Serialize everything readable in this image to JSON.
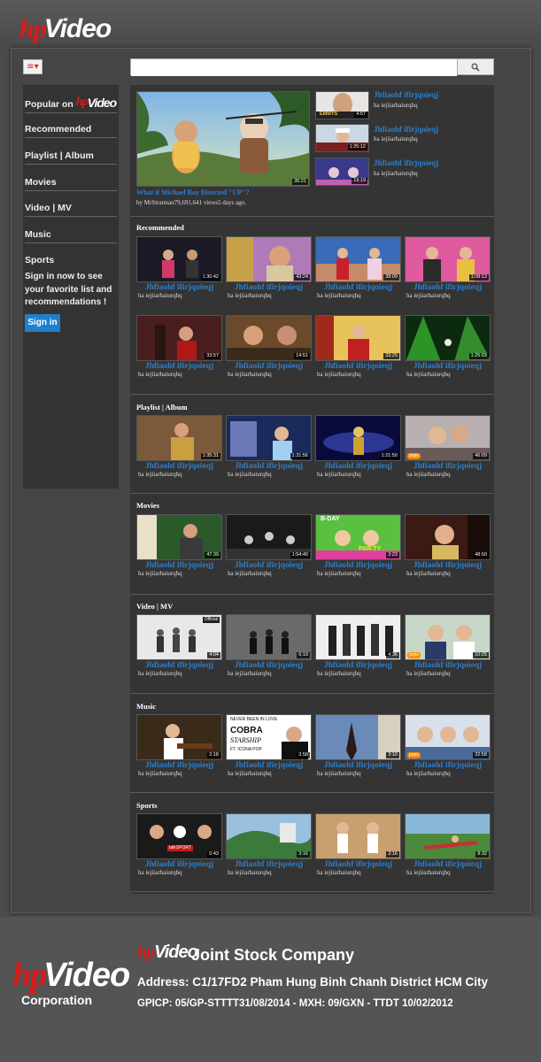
{
  "brand": {
    "hp": "hp",
    "video": "Video"
  },
  "search": {
    "placeholder": ""
  },
  "sidebar": {
    "popular_prefix": "Popular on",
    "items": [
      "Recommended",
      "Playlist | Album",
      "Movies",
      "Video | MV",
      "Music",
      "Sports"
    ],
    "prompt": "Sign in now to see your favorite list and recommendations !",
    "signin_label": "Sign in"
  },
  "featured": {
    "title": "What if Michael Bay Directed \"UP\"?",
    "meta": "by MrStratman79,691,641 views5 days ago.",
    "duration": "35:21",
    "side": [
      {
        "title": "Jhfiaohf ifirjqoieqj",
        "sub": "ha iejiiarhaiurqhq",
        "duration": "4:57"
      },
      {
        "title": "Jhfiaohf ifirjqoieqj",
        "sub": "ha iejiiarhaiurqhq",
        "duration": "1:25:12"
      },
      {
        "title": "Jhfiaohf ifirjqoieqj",
        "sub": "ha iejiiarhaiurqhq",
        "duration": "19:19"
      }
    ]
  },
  "sections": [
    {
      "title": "Recommended",
      "cards": [
        {
          "title": "Jhfiaohf ifirjqoieqj",
          "sub": "ha iejiiarhaiurqhq",
          "duration": "1:30:42"
        },
        {
          "title": "Jhfiaohf ifirjqoieqj",
          "sub": "ha iejiiarhaiurqhq",
          "duration": "43:24"
        },
        {
          "title": "Jhfiaohf ifirjqoieqj",
          "sub": "ha iejiiarhaiurqhq",
          "duration": "38:09"
        },
        {
          "title": "Jhfiaohf ifirjqoieqj",
          "sub": "ha iejiiarhaiurqhq",
          "duration": "1:08:13"
        },
        {
          "title": "Jhfiaohf ifirjqoieqj",
          "sub": "ha iejiiarhaiurqhq",
          "duration": "33:57"
        },
        {
          "title": "Jhfiaohf ifirjqoieqj",
          "sub": "ha iejiiarhaiurqhq",
          "duration": "14:51"
        },
        {
          "title": "Jhfiaohf ifirjqoieqj",
          "sub": "ha iejiiarhaiurqhq",
          "duration": "33:25"
        },
        {
          "title": "Jhfiaohf ifirjqoieqj",
          "sub": "ha iejiiarhaiurqhq",
          "duration": "1:25:03"
        }
      ]
    },
    {
      "title": "Playlist | Album",
      "cards": [
        {
          "title": "Jhfiaohf ifirjqoieqj",
          "sub": "ha iejiiarhaiurqhq",
          "duration": "1:35:31"
        },
        {
          "title": "Jhfiaohf ifirjqoieqj",
          "sub": "ha iejiiarhaiurqhq",
          "duration": "1:31:56"
        },
        {
          "title": "Jhfiaohf ifirjqoieqj",
          "sub": "ha iejiiarhaiurqhq",
          "duration": "1:21:50"
        },
        {
          "title": "Jhfiaohf ifirjqoieqj",
          "sub": "ha iejiiarhaiurqhq",
          "duration": "46:09",
          "badge": "pops"
        }
      ]
    },
    {
      "title": "Movies",
      "cards": [
        {
          "title": "Jhfiaohf ifirjqoieqj",
          "sub": "ha iejiiarhaiurqhq",
          "duration": "47:39"
        },
        {
          "title": "Jhfiaohf ifirjqoieqj",
          "sub": "ha iejiiarhaiurqhq",
          "duration": "1:54:40"
        },
        {
          "title": "Jhfiaohf ifirjqoieqj",
          "sub": "ha iejiiarhaiurqhq",
          "duration": "3:23"
        },
        {
          "title": "Jhfiaohf ifirjqoieqj",
          "sub": "ha iejiiarhaiurqhq",
          "duration": "48:50"
        }
      ]
    },
    {
      "title": "Video | MV",
      "cards": [
        {
          "title": "Jhfiaohf ifirjqoieqj",
          "sub": "ha iejiiarhaiurqhq",
          "duration": "4:04"
        },
        {
          "title": "Jhfiaohf ifirjqoieqj",
          "sub": "ha iejiiarhaiurqhq",
          "duration": "6:19"
        },
        {
          "title": "Jhfiaohf ifirjqoieqj",
          "sub": "ha iejiiarhaiurqhq",
          "duration": "4:36"
        },
        {
          "title": "Jhfiaohf ifirjqoieqj",
          "sub": "ha iejiiarhaiurqhq",
          "duration": "10:25",
          "badge": "pops"
        }
      ]
    },
    {
      "title": "Music",
      "cards": [
        {
          "title": "Jhfiaohf ifirjqoieqj",
          "sub": "ha iejiiarhaiurqhq",
          "duration": "2:18"
        },
        {
          "title": "Jhfiaohf ifirjqoieqj",
          "sub": "ha iejiiarhaiurqhq",
          "duration": "3:58"
        },
        {
          "title": "Jhfiaohf ifirjqoieqj",
          "sub": "ha iejiiarhaiurqhq",
          "duration": "3:10"
        },
        {
          "title": "Jhfiaohf ifirjqoieqj",
          "sub": "ha iejiiarhaiurqhq",
          "duration": "32:58",
          "badge": "pops"
        }
      ]
    },
    {
      "title": "Sports",
      "cards": [
        {
          "title": "Jhfiaohf ifirjqoieqj",
          "sub": "ha iejiiarhaiurqhq",
          "duration": "0:43"
        },
        {
          "title": "Jhfiaohf ifirjqoieqj",
          "sub": "ha iejiiarhaiurqhq",
          "duration": "3:16"
        },
        {
          "title": "Jhfiaohf ifirjqoieqj",
          "sub": "ha iejiiarhaiurqhq",
          "duration": "3:16"
        },
        {
          "title": "Jhfiaohf ifirjqoieqj",
          "sub": "ha iejiiarhaiurqhq",
          "duration": "8:32"
        }
      ]
    }
  ],
  "thumbnail_text": {
    "emmys": "EMMYS",
    "official": "Official",
    "bday": "B-DAY",
    "party": "PAR.TY",
    "talksport": "talkSPORT",
    "music_cover": [
      "NEVER BEEN IN LOVE",
      "COBRA",
      "STARSHIP",
      "FT. ICONA POP"
    ]
  },
  "footer": {
    "company": "Joint Stock Company",
    "address": "Address: C1/17FD2 Pham Hung Binh Chanh District HCM City",
    "license": "GPICP: 05/GP-STTTT31/08/2014 - MXH: 09/GXN - TTDT 10/02/2012",
    "corporation": "Corporation"
  },
  "colors": {
    "accent": "#2e7ec9",
    "brand_red": "#e01818",
    "signin": "#1f7fcf",
    "background": "#4b4b4b",
    "panel": "#343434"
  },
  "icons": {
    "menu": "hamburger-menu-icon",
    "search": "search-icon"
  }
}
